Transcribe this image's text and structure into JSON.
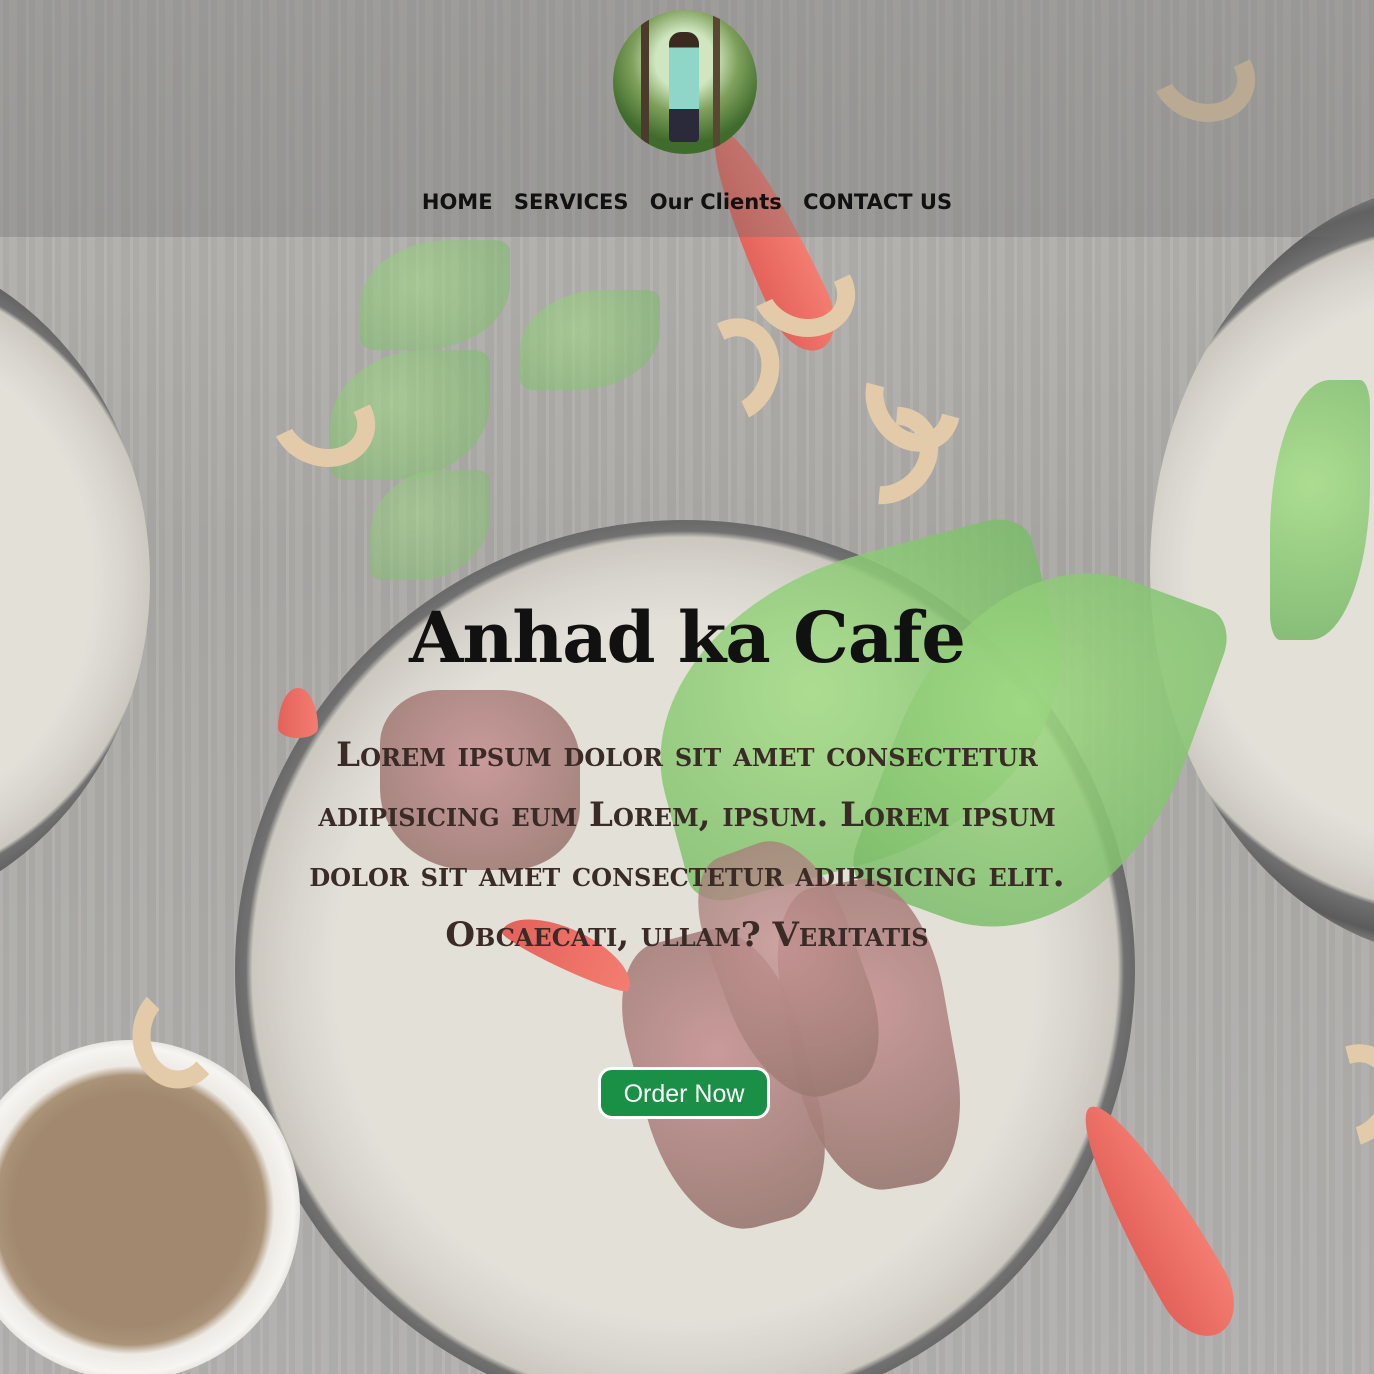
{
  "brand": {
    "avatar_alt": "profile photo"
  },
  "nav": {
    "items": [
      "HOME",
      "SERVICES",
      "Our Clients",
      "CONTACT US"
    ]
  },
  "hero": {
    "title": "Anhad ka Cafe",
    "description": "Lorem ipsum dolor sit amet consectetur adipisicing eum Lorem, ipsum. Lorem ipsum dolor sit amet consectetur adipisicing elit. Obcaecati, ullam? Veritatis",
    "cta_label": "Order Now"
  },
  "colors": {
    "cta_background": "#1a8f46",
    "header_overlay": "rgba(110,110,110,0.35)"
  }
}
